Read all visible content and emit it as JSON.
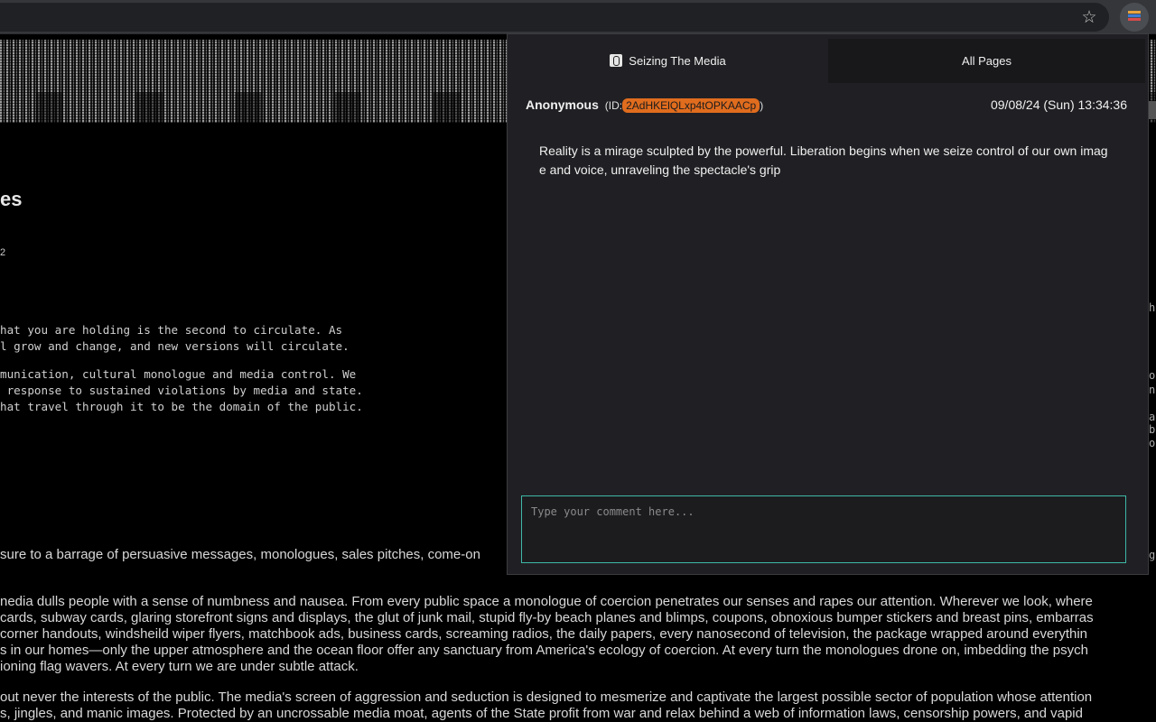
{
  "browser": {
    "star_icon": "☆",
    "extension_icon_colors": [
      "#e8a33d",
      "#3a7bd5",
      "#d84b4b"
    ]
  },
  "page": {
    "title_fragment": "es",
    "page_number_fragment": "2",
    "mono_para_1": "hat you are holding is the second to circulate. As\nl grow and change, and new versions will circulate.",
    "mono_para_2": "munication, cultural monologue and media control. We\n response to sustained violations by media and state.\nhat travel through it to be the domain of the public.",
    "sans_line_0": "sure to a barrage of persuasive messages, monologues, sales pitches, come-on",
    "sans_para_1": "nedia dulls people with a sense of numbness and nausea. From every public space a monologue of coercion penetrates our senses and rapes our attention. Wherever we look, where\ncards, subway cards, glaring storefront signs and displays, the glut of junk mail, stupid fly-by beach planes and blimps, coupons, obnoxious bumper stickers and breast pins, embarras\ncorner handouts, windsheild wiper flyers, matchbook ads, business cards, screaming radios, the daily papers, every nanosecond of television, the package wrapped around everythin\ns in our homes—only the upper atmosphere and the ocean floor offer any sanctuary from America's ecology of coercion. At every turn the monologues drone on, imbedding the psych\nioning flag wavers. At every turn we are under subtle attack.",
    "sans_para_2": "out never the interests of the public. The media's screen of aggression and seduction is designed to mesmerize and captivate the largest possible sector of population whose attention\ns, jingles, and manic images. Protected by an uncrossable media moat, agents of the State profit from war and relax behind a web of information laws, censorship powers, and vapid",
    "edge_fragments": [
      "he",
      "o",
      "n",
      "a",
      "b",
      "o",
      "g"
    ]
  },
  "popup": {
    "tabs": [
      {
        "label": "Seizing The Media",
        "active": true
      },
      {
        "label": "All Pages",
        "active": false
      }
    ],
    "post": {
      "author": "Anonymous",
      "id_prefix": "(ID:",
      "id_value": "2AdHKElQLxp4tOPKAACp",
      "id_suffix": ")",
      "timestamp": "09/08/24 (Sun) 13:34:36",
      "body": "Reality is a mirage sculpted by the powerful. Liberation begins when we seize control of our own image and voice, unraveling the spectacle's grip"
    },
    "comment": {
      "placeholder": "Type your comment here...",
      "value": ""
    }
  }
}
